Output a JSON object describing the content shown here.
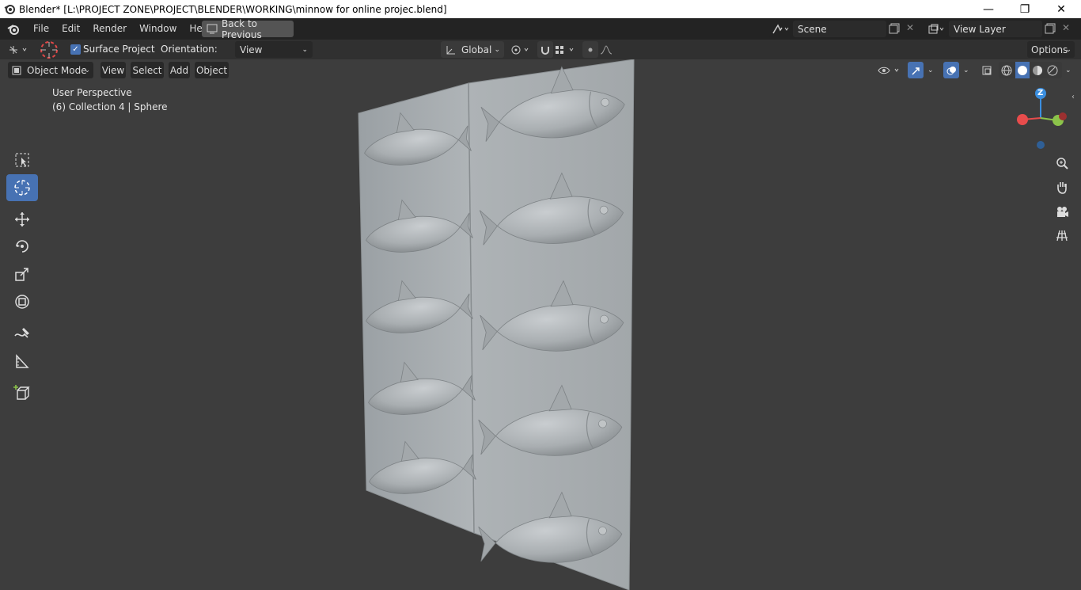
{
  "window": {
    "title": "Blender* [L:\\PROJECT ZONE\\PROJECT\\BLENDER\\WORKING\\minnow for online projec.blend]",
    "minimize_glyph": "—",
    "restore_glyph": "❐",
    "close_glyph": "✕"
  },
  "menubar": {
    "items": [
      "File",
      "Edit",
      "Render",
      "Window",
      "Help"
    ],
    "back_label": "Back to Previous",
    "scene_label": "Scene",
    "view_layer_label": "View Layer"
  },
  "tool_header": {
    "surface_project_label": "Surface Project",
    "surface_project_checked": true,
    "orientation_label": "Orientation:",
    "orientation_value": "View",
    "transform_orientation": "Global",
    "options_label": "Options"
  },
  "viewport_header": {
    "mode": "Object Mode",
    "menus": [
      "View",
      "Select",
      "Add",
      "Object"
    ]
  },
  "viewport": {
    "perspective_label": "User Perspective",
    "collection_label": "(6) Collection 4 | Sphere",
    "gizmo_axis_label": "Z"
  },
  "colors": {
    "accent": "#4772b3",
    "x_axis": "#e84c4c",
    "y_axis": "#8bc34a",
    "z_axis": "#3b8fe0",
    "background": "#3d3d3d"
  },
  "icons": {
    "tools": [
      "select-box-icon",
      "cursor-icon",
      "move-icon",
      "rotate-icon",
      "scale-icon",
      "transform-icon",
      "annotate-icon",
      "measure-icon",
      "add-cube-icon"
    ],
    "nav": [
      "zoom-icon",
      "pan-hand-icon",
      "camera-icon",
      "grid-icon"
    ]
  }
}
